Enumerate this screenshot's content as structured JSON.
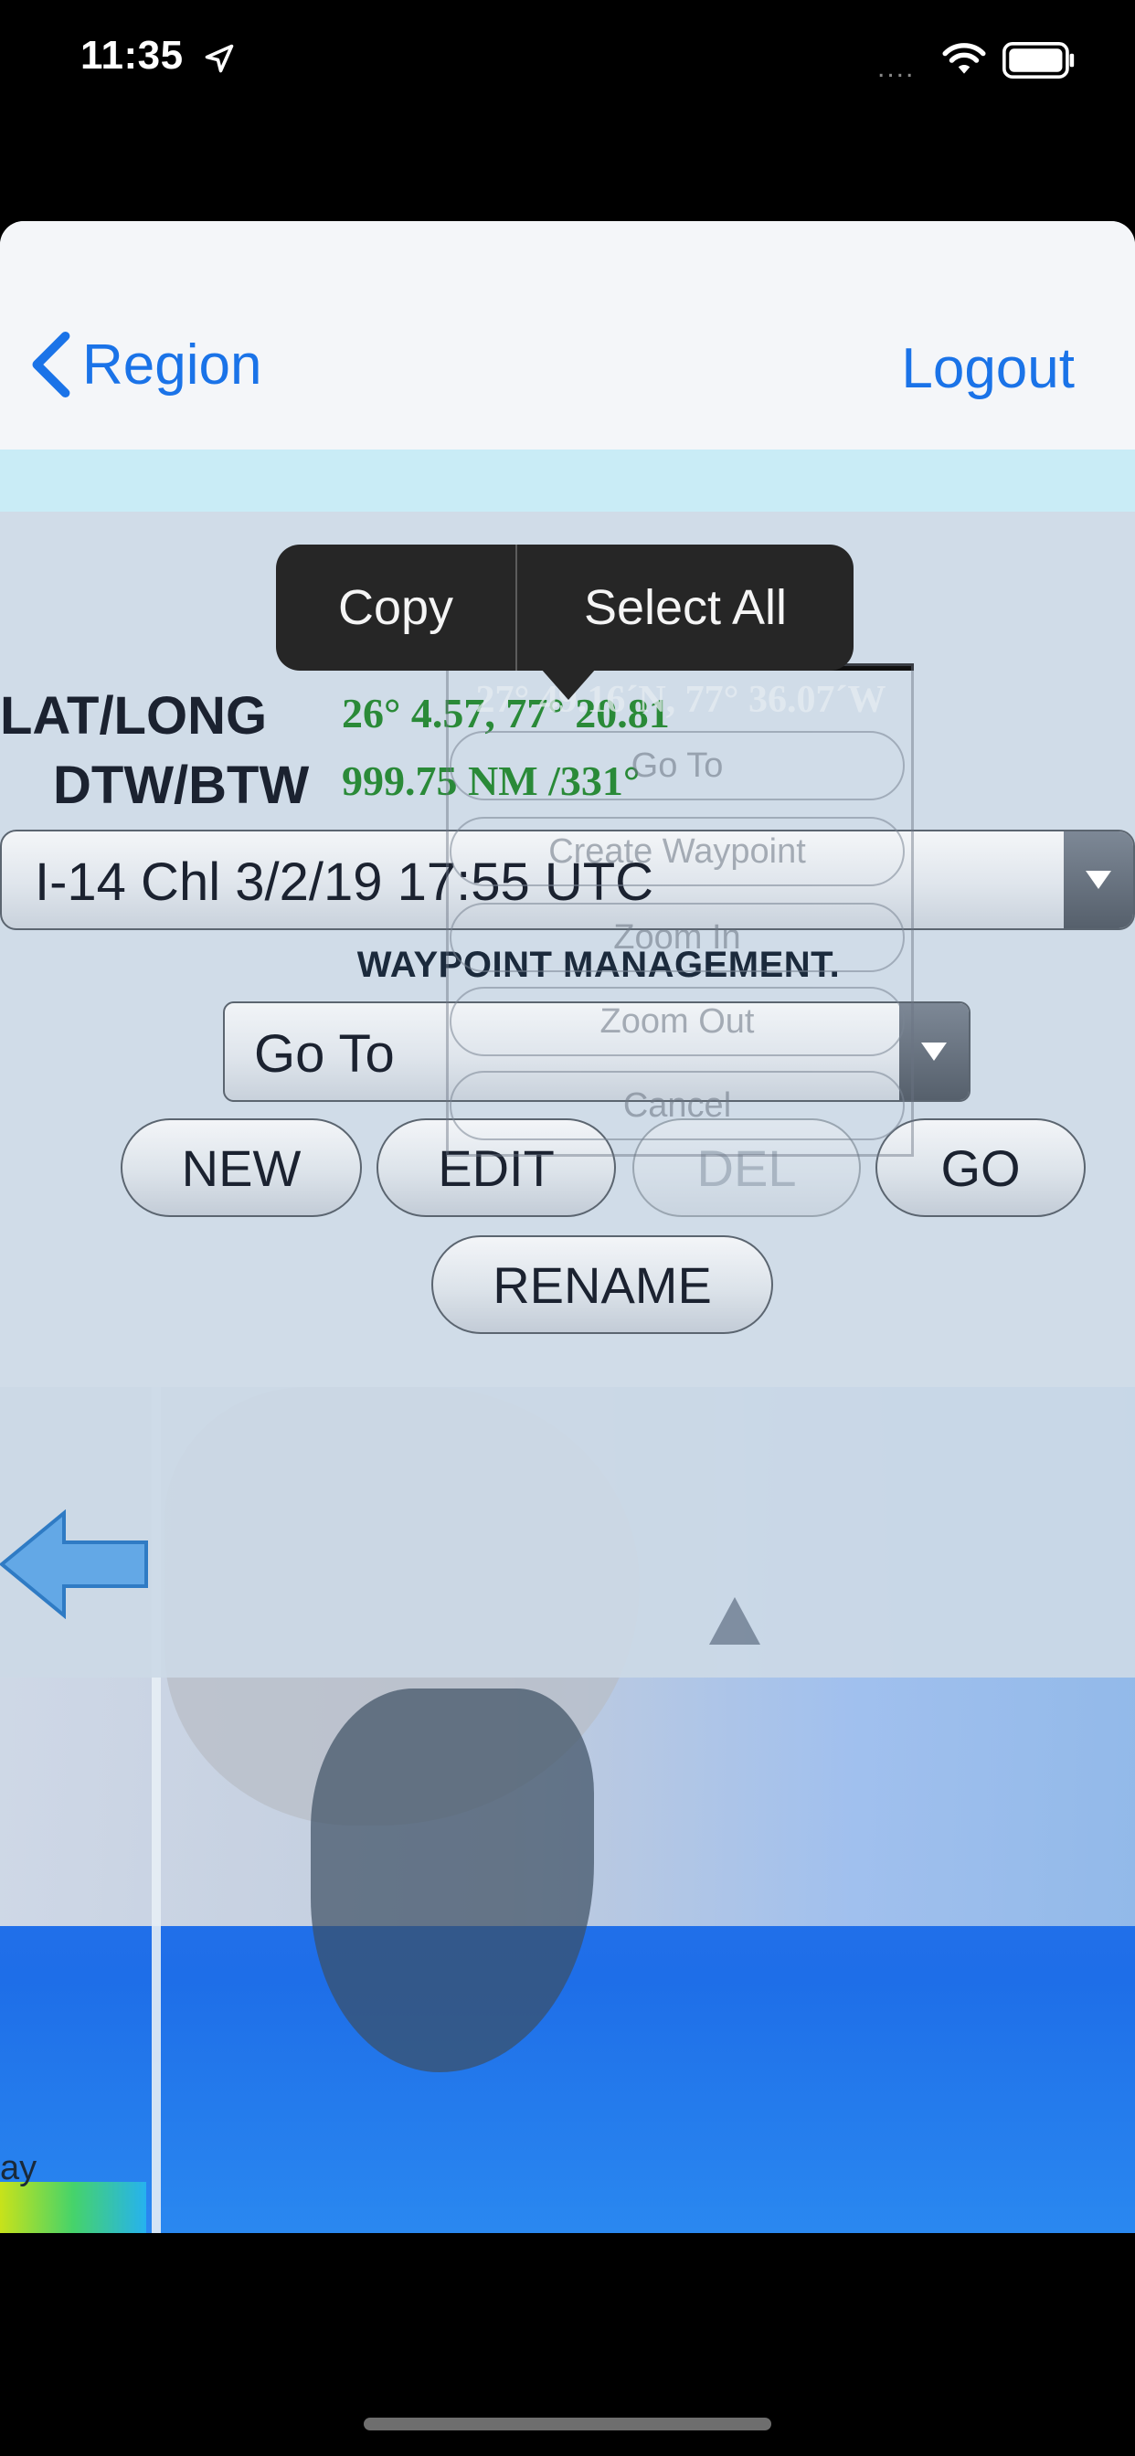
{
  "status_bar": {
    "time": "11:35",
    "signal": "....",
    "wifi_icon": "wifi-icon",
    "battery_icon": "battery-icon",
    "location_icon": "location-arrow-icon"
  },
  "nav": {
    "back_label": "Region",
    "logout_label": "Logout"
  },
  "context_menu": {
    "copy": "Copy",
    "select_all": "Select All"
  },
  "position": {
    "lat_long_label": "LAT/LONG",
    "lat_long_value": "26° 4.57, 77° 20.81",
    "dtw_btw_label": "DTW/BTW",
    "dtw_btw_value": "999.75 NM /331°"
  },
  "chart_select": {
    "value": "I-14 Chl 3/2/19 17:55 UTC"
  },
  "waypoint": {
    "title": "WAYPOINT MANAGEMENT.",
    "action_value": "Go To",
    "buttons": {
      "new": "NEW",
      "edit": "EDIT",
      "del": "DEL",
      "go": "GO",
      "rename": "RENAME"
    }
  },
  "ghost_menu": {
    "coords": "27° 49.16´N, 77° 36.07´W",
    "items": [
      "Go To",
      "Create Waypoint",
      "Zoom In",
      "Zoom Out",
      "Cancel"
    ]
  },
  "map": {
    "label": "ay"
  },
  "colors": {
    "accent": "#1a73e8",
    "value_green": "#2a8a38",
    "panel": "#ccd9e6",
    "popover": "#262626"
  }
}
